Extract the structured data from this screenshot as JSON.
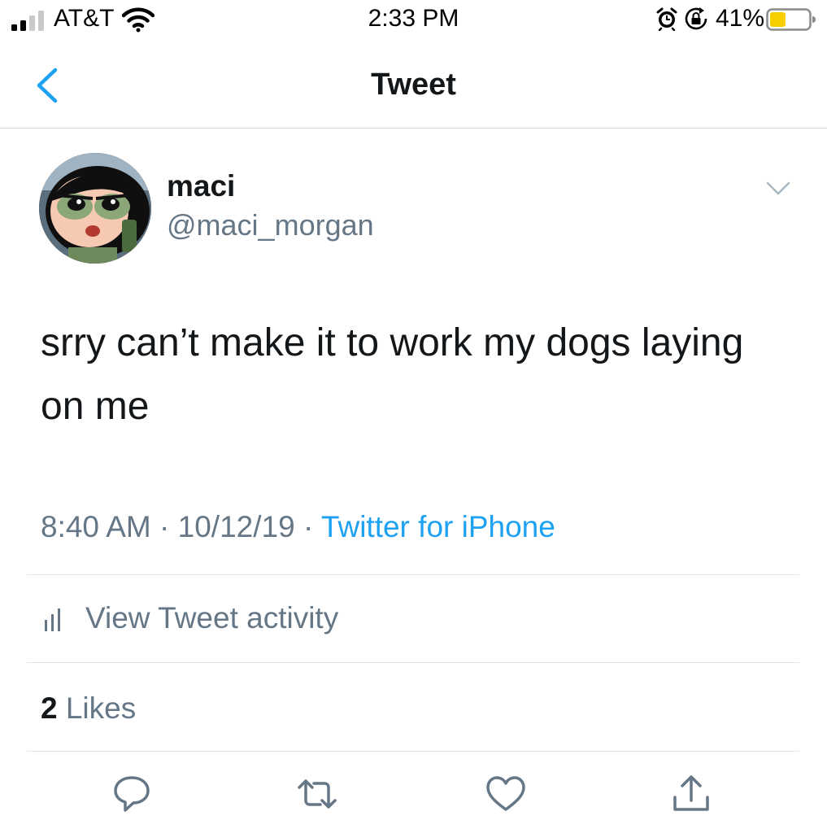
{
  "status_bar": {
    "carrier": "AT&T",
    "time": "2:33 PM",
    "battery_percent": "41%",
    "battery_level": 0.41,
    "signal_bars": 2,
    "icons": [
      "signal-icon",
      "wifi-icon",
      "alarm-icon",
      "rotation-lock-icon",
      "battery-icon"
    ]
  },
  "nav": {
    "title": "Tweet",
    "back_icon": "chevron-left-icon"
  },
  "tweet": {
    "author_name": "maci",
    "author_handle": "@maci_morgan",
    "text": "srry can’t make it to work my dogs laying on me",
    "time": "8:40 AM",
    "date": "10/12/19",
    "separator": "·",
    "source": "Twitter for iPhone",
    "activity_label": "View Tweet activity",
    "likes_count": "2",
    "likes_label": "Likes",
    "actions": [
      "reply-icon",
      "retweet-icon",
      "like-icon",
      "share-icon"
    ]
  },
  "colors": {
    "accent": "#1da1f2",
    "text_primary": "#14171a",
    "text_secondary": "#657786",
    "divider": "#dfe5e9",
    "battery_low": "#f7ce00"
  }
}
